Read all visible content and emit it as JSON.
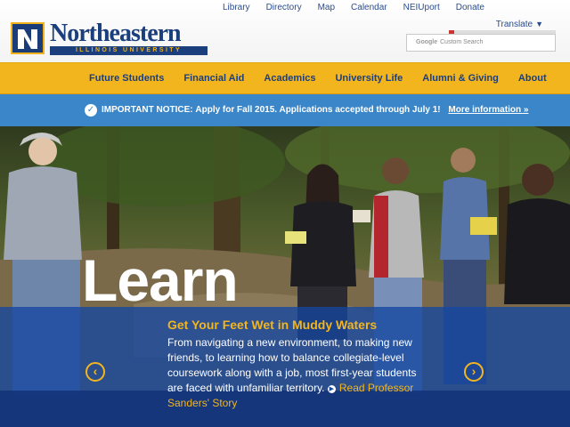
{
  "top_links": [
    "Library",
    "Directory",
    "Map",
    "Calendar",
    "NEIUport",
    "Donate"
  ],
  "translate_label": "Translate",
  "search_placeholder": "Custom Search",
  "search_brand": "Google",
  "logo": {
    "name": "Northeastern",
    "subtitle": "ILLINOIS UNIVERSITY"
  },
  "nav": [
    "Future Students",
    "Financial Aid",
    "Academics",
    "University Life",
    "Alumni & Giving",
    "About"
  ],
  "notice": {
    "label": "IMPORTANT NOTICE:",
    "message": "Apply for Fall 2015. Applications accepted through July 1!",
    "link": "More information »"
  },
  "hero": {
    "headline": "Learn",
    "title": "Get Your Feet Wet in Muddy Waters",
    "body": "From navigating a new environment, to making new friends, to learning how to balance collegiate-level coursework along with a job, most first-year students are faced with unfamiliar territory.",
    "readmore": "Read Professor Sanders' Story",
    "prev_icon": "‹",
    "next_icon": "›"
  },
  "colors": {
    "navy": "#1b3f7d",
    "gold": "#f3b51e",
    "notice_blue": "#3b86c8"
  }
}
